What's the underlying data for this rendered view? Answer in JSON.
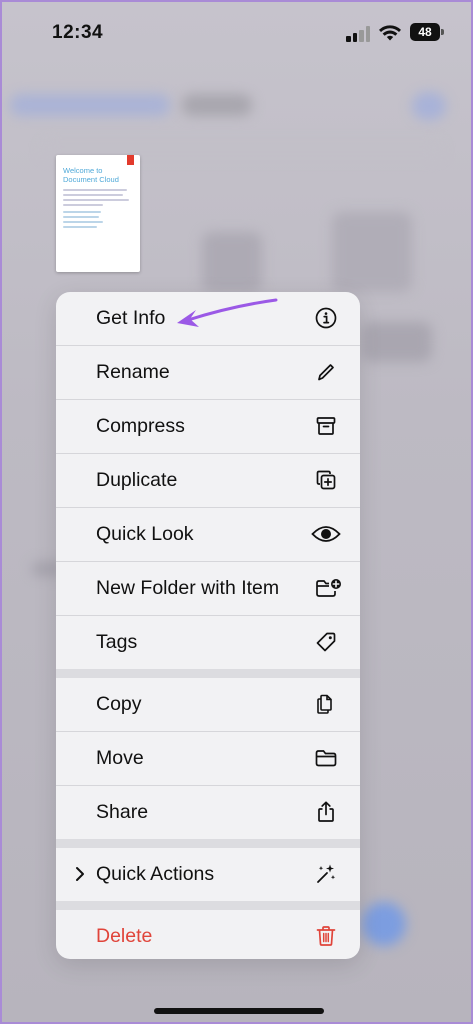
{
  "status": {
    "time": "12:34",
    "battery": "48"
  },
  "thumbnail": {
    "title": "Welcome to Document Cloud"
  },
  "menu": {
    "group1": [
      {
        "label": "Get Info",
        "icon": "info-icon"
      },
      {
        "label": "Rename",
        "icon": "pencil-icon"
      },
      {
        "label": "Compress",
        "icon": "archive-box-icon"
      },
      {
        "label": "Duplicate",
        "icon": "duplicate-icon"
      },
      {
        "label": "Quick Look",
        "icon": "eye-icon"
      },
      {
        "label": "New Folder with Item",
        "icon": "folder-plus-icon"
      },
      {
        "label": "Tags",
        "icon": "tag-icon"
      }
    ],
    "group2": [
      {
        "label": "Copy",
        "icon": "copy-icon"
      },
      {
        "label": "Move",
        "icon": "folder-icon"
      },
      {
        "label": "Share",
        "icon": "share-icon"
      }
    ],
    "quick_actions": {
      "label": "Quick Actions",
      "icon": "sparkles-icon"
    },
    "delete": {
      "label": "Delete",
      "icon": "trash-icon"
    }
  },
  "colors": {
    "destructive": "#e0443a",
    "annotation_arrow": "#9b59e6",
    "frame_border": "#a98bd6"
  }
}
